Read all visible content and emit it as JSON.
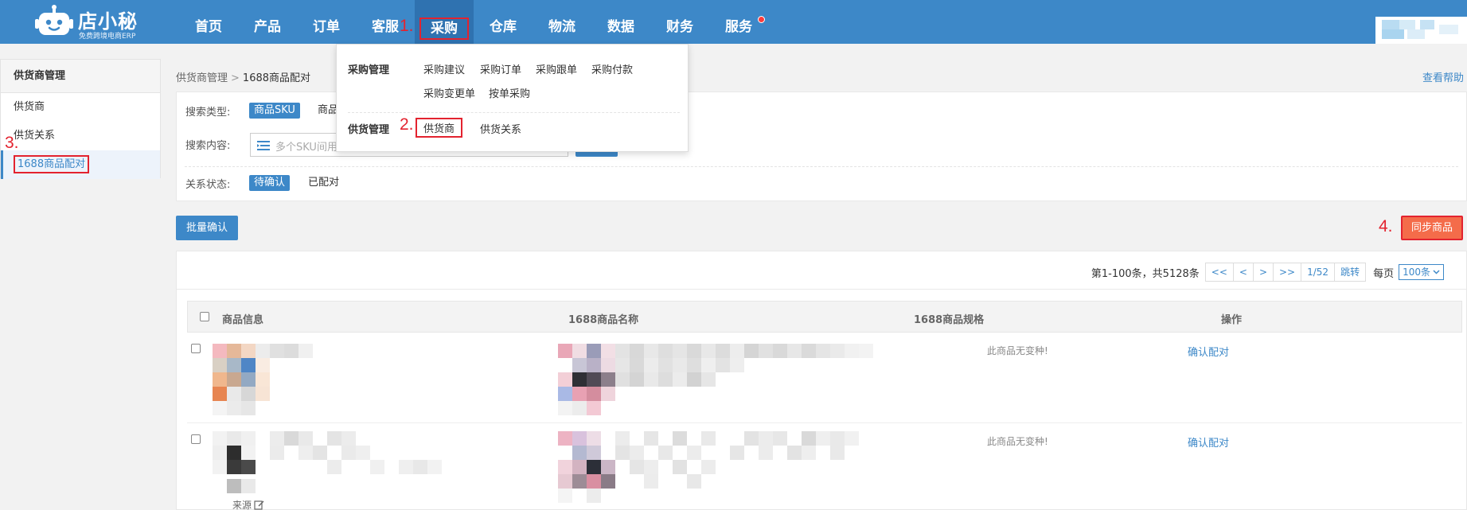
{
  "brand": {
    "name": "店小秘",
    "tagline": "免费跨境电商ERP"
  },
  "nav": {
    "items": [
      {
        "label": "首页"
      },
      {
        "label": "产品"
      },
      {
        "label": "订单"
      },
      {
        "label": "客服"
      },
      {
        "label": "采购",
        "active": true
      },
      {
        "label": "仓库"
      },
      {
        "label": "物流"
      },
      {
        "label": "数据"
      },
      {
        "label": "财务"
      },
      {
        "label": "服务",
        "has_notification": true
      }
    ]
  },
  "annotations": {
    "step1": "1.",
    "step2": "2.",
    "step3": "3.",
    "step4": "4."
  },
  "dropdown": {
    "purchase_group_label": "采购管理",
    "purchase_links": [
      "采购建议",
      "采购订单",
      "采购跟单",
      "采购付款",
      "采购变更单",
      "按单采购"
    ],
    "supply_group_label": "供货管理",
    "supply_links": [
      "供货商",
      "供货关系"
    ]
  },
  "sidebar": {
    "title": "供货商管理",
    "items": [
      {
        "label": "供货商"
      },
      {
        "label": "供货关系"
      },
      {
        "label": "1688商品配对",
        "active": true
      }
    ]
  },
  "breadcrumb": {
    "parent": "供货商管理",
    "separator": ">",
    "current": "1688商品配对"
  },
  "help_link": "查看帮助",
  "search": {
    "type_label": "搜索类型:",
    "type_selected": "商品SKU",
    "type_other_partial": "商品",
    "content_label": "搜索内容:",
    "placeholder": "多个SKU间用",
    "status_label": "关系状态:",
    "status_selected": "待确认",
    "status_other": "已配对"
  },
  "buttons": {
    "batch_confirm": "批量确认",
    "sync_products": "同步商品"
  },
  "pagination": {
    "info": "第1-100条，共5128条",
    "first": "<<",
    "prev": "<",
    "next": ">",
    "last": ">>",
    "page": "1/52",
    "jump": "跳转",
    "per_page_label": "每页",
    "per_page_value": "100条"
  },
  "table": {
    "headers": {
      "product_info": "商品信息",
      "name_1688": "1688商品名称",
      "spec_1688": "1688商品规格",
      "actions": "操作"
    },
    "rows": [
      {
        "spec": "此商品无变种!",
        "action": "确认配对"
      },
      {
        "spec": "此商品无变种!",
        "action": "确认配对",
        "source_label": "来源"
      }
    ]
  },
  "colors": {
    "primary": "#3d88c8",
    "nav_active": "#2f72b0",
    "annotation_red": "#e3232f",
    "sync_button": "#f46c4a"
  }
}
